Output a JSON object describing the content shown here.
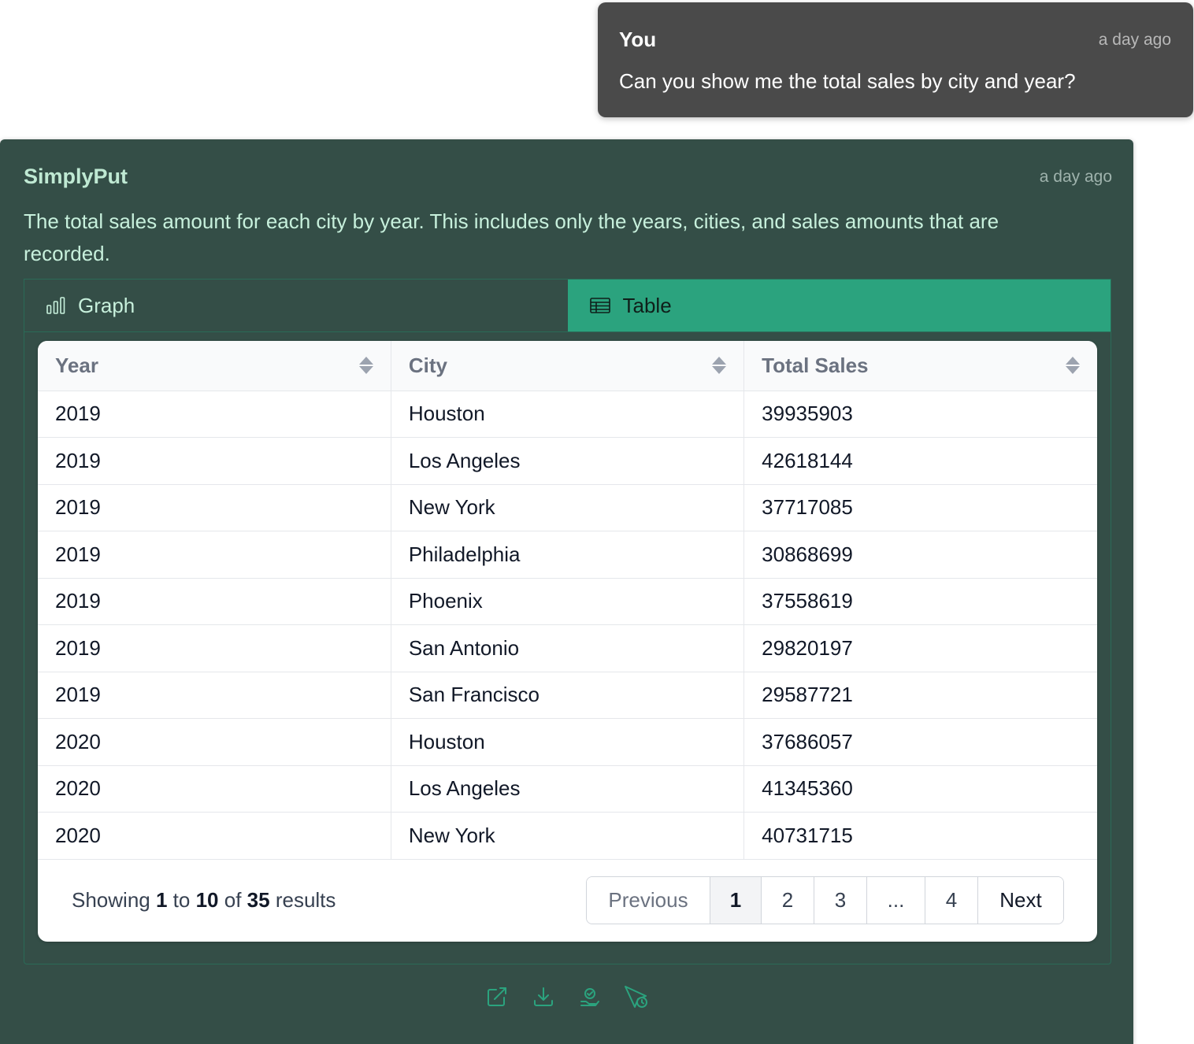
{
  "user_message": {
    "author": "You",
    "time": "a day ago",
    "text": "Can you show me the total sales by city and year?"
  },
  "bot_message": {
    "author": "SimplyPut",
    "time": "a day ago",
    "text": "The total sales amount for each city by year. This includes only the years, cities, and sales amounts that are recorded.",
    "tabs": [
      {
        "label": "Graph",
        "icon": "bar-chart-icon",
        "active": false
      },
      {
        "label": "Table",
        "icon": "table-icon",
        "active": true
      }
    ],
    "colors": {
      "card_bg": "#344e47",
      "active_tab": "#2ba37e",
      "bot_name": "#bfe9d3",
      "user_bubble_bg": "#4a4a4a"
    }
  },
  "table": {
    "columns": [
      "Year",
      "City",
      "Total Sales"
    ],
    "rows": [
      [
        "2019",
        "Houston",
        "39935903"
      ],
      [
        "2019",
        "Los Angeles",
        "42618144"
      ],
      [
        "2019",
        "New York",
        "37717085"
      ],
      [
        "2019",
        "Philadelphia",
        "30868699"
      ],
      [
        "2019",
        "Phoenix",
        "37558619"
      ],
      [
        "2019",
        "San Antonio",
        "29820197"
      ],
      [
        "2019",
        "San Francisco",
        "29587721"
      ],
      [
        "2020",
        "Houston",
        "37686057"
      ],
      [
        "2020",
        "Los Angeles",
        "41345360"
      ],
      [
        "2020",
        "New York",
        "40731715"
      ]
    ]
  },
  "pagination": {
    "showing_prefix": "Showing",
    "from": "1",
    "to_word": "to",
    "to": "10",
    "of_word": "of",
    "total": "35",
    "results_word": "results",
    "previous": "Previous",
    "pages": [
      "1",
      "2",
      "3",
      "...",
      "4"
    ],
    "current_page": "1",
    "next": "Next"
  },
  "actions": [
    {
      "name": "open-external-icon"
    },
    {
      "name": "download-icon"
    },
    {
      "name": "insight-icon"
    },
    {
      "name": "send-schedule-icon"
    }
  ]
}
